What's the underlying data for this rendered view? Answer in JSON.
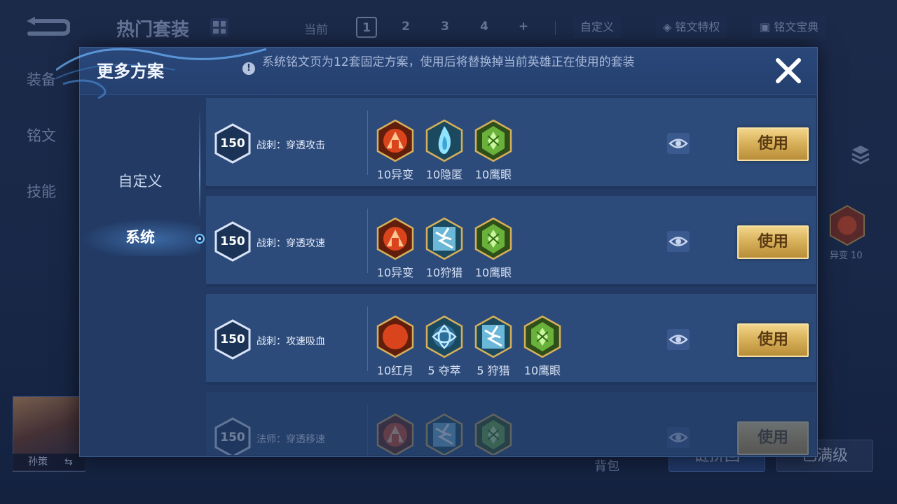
{
  "background": {
    "title": "热门套装",
    "current_label": "当前",
    "pages": [
      "1",
      "2",
      "3",
      "4",
      "+"
    ],
    "active_page": "1",
    "custom_label": "自定义",
    "privilege_label": "铭文特权",
    "codex_label": "铭文宝典",
    "side_tabs": [
      "装备",
      "铭文",
      "技能"
    ],
    "hero_name": "孙策",
    "swap_icon": "⇆",
    "bag_label": "背包",
    "btn_partial_left": "链拼回",
    "btn_right": "已满级",
    "rune_right_label": "异变 10"
  },
  "modal": {
    "title": "更多方案",
    "notice": "系统铭文页为12套固定方案，使用后将替换掉当前英雄正在使用的套装",
    "notice_icon": "!",
    "close_icon": "close-icon"
  },
  "sidebar": {
    "tabs": [
      {
        "label": "自定义",
        "active": false
      },
      {
        "label": "系统",
        "active": true
      }
    ]
  },
  "presets": [
    {
      "level": "150",
      "name": "战刺：穿透攻击",
      "use_label": "使用",
      "runes": [
        {
          "label": "10异变",
          "type": "red-gate",
          "color": "#d9441c"
        },
        {
          "label": "10隐匿",
          "type": "blue-flame",
          "color": "#3ea3d6"
        },
        {
          "label": "10鹰眼",
          "type": "green-gem",
          "color": "#6ab13b"
        }
      ]
    },
    {
      "level": "150",
      "name": "战刺：穿透攻速",
      "use_label": "使用",
      "runes": [
        {
          "label": "10异变",
          "type": "red-gate",
          "color": "#d9441c"
        },
        {
          "label": "10狩猎",
          "type": "blue-bolt",
          "color": "#3ea3d6"
        },
        {
          "label": "10鹰眼",
          "type": "green-gem",
          "color": "#6ab13b"
        }
      ]
    },
    {
      "level": "150",
      "name": "战刺：攻速吸血",
      "use_label": "使用",
      "runes": [
        {
          "label": "10红月",
          "type": "red-moon",
          "color": "#d9441c"
        },
        {
          "label": "5 夺萃",
          "type": "blue-knot",
          "color": "#3ea3d6"
        },
        {
          "label": "5 狩猎",
          "type": "blue-bolt",
          "color": "#3ea3d6"
        },
        {
          "label": "10鹰眼",
          "type": "green-gem",
          "color": "#6ab13b"
        }
      ]
    },
    {
      "level": "150",
      "name": "法师：穿透移速",
      "use_label": "使用",
      "runes": [
        {
          "label": "",
          "type": "red-gate",
          "color": "#d9441c"
        },
        {
          "label": "",
          "type": "blue-bolt",
          "color": "#3ea3d6"
        },
        {
          "label": "",
          "type": "green-gem",
          "color": "#6ab13b"
        }
      ]
    }
  ]
}
